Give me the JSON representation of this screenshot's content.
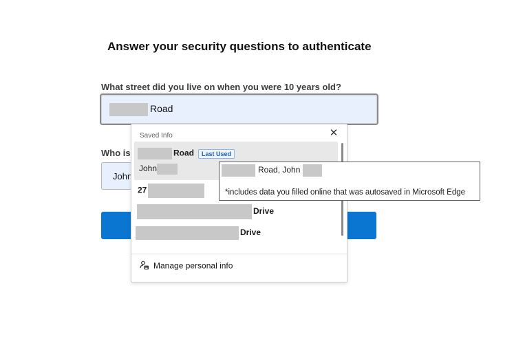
{
  "page": {
    "heading": "Answer your security questions to authenticate",
    "question1": "What street did you live on when you were 10 years old?",
    "answer1_suffix": "Road",
    "question2_prefix": "Who is",
    "answer2_prefix": "John"
  },
  "autofill": {
    "title": "Saved Info",
    "close_icon": "close-icon",
    "items": [
      {
        "line1_suffix": "Road",
        "badge": "Last Used",
        "line2_prefix": "John"
      },
      {
        "prefix": "27"
      },
      {
        "suffix": "Drive"
      },
      {
        "suffix": "Drive"
      }
    ],
    "manage_label": "Manage personal info",
    "manage_icon": "person-card-icon"
  },
  "tooltip": {
    "line1_mid": "Road, John",
    "line2": "*includes data you filled online that was autosaved in Microsoft Edge"
  },
  "colors": {
    "accent": "#0a76d1",
    "field_fill": "#e8f0fe",
    "badge_text": "#1a5fb4"
  }
}
